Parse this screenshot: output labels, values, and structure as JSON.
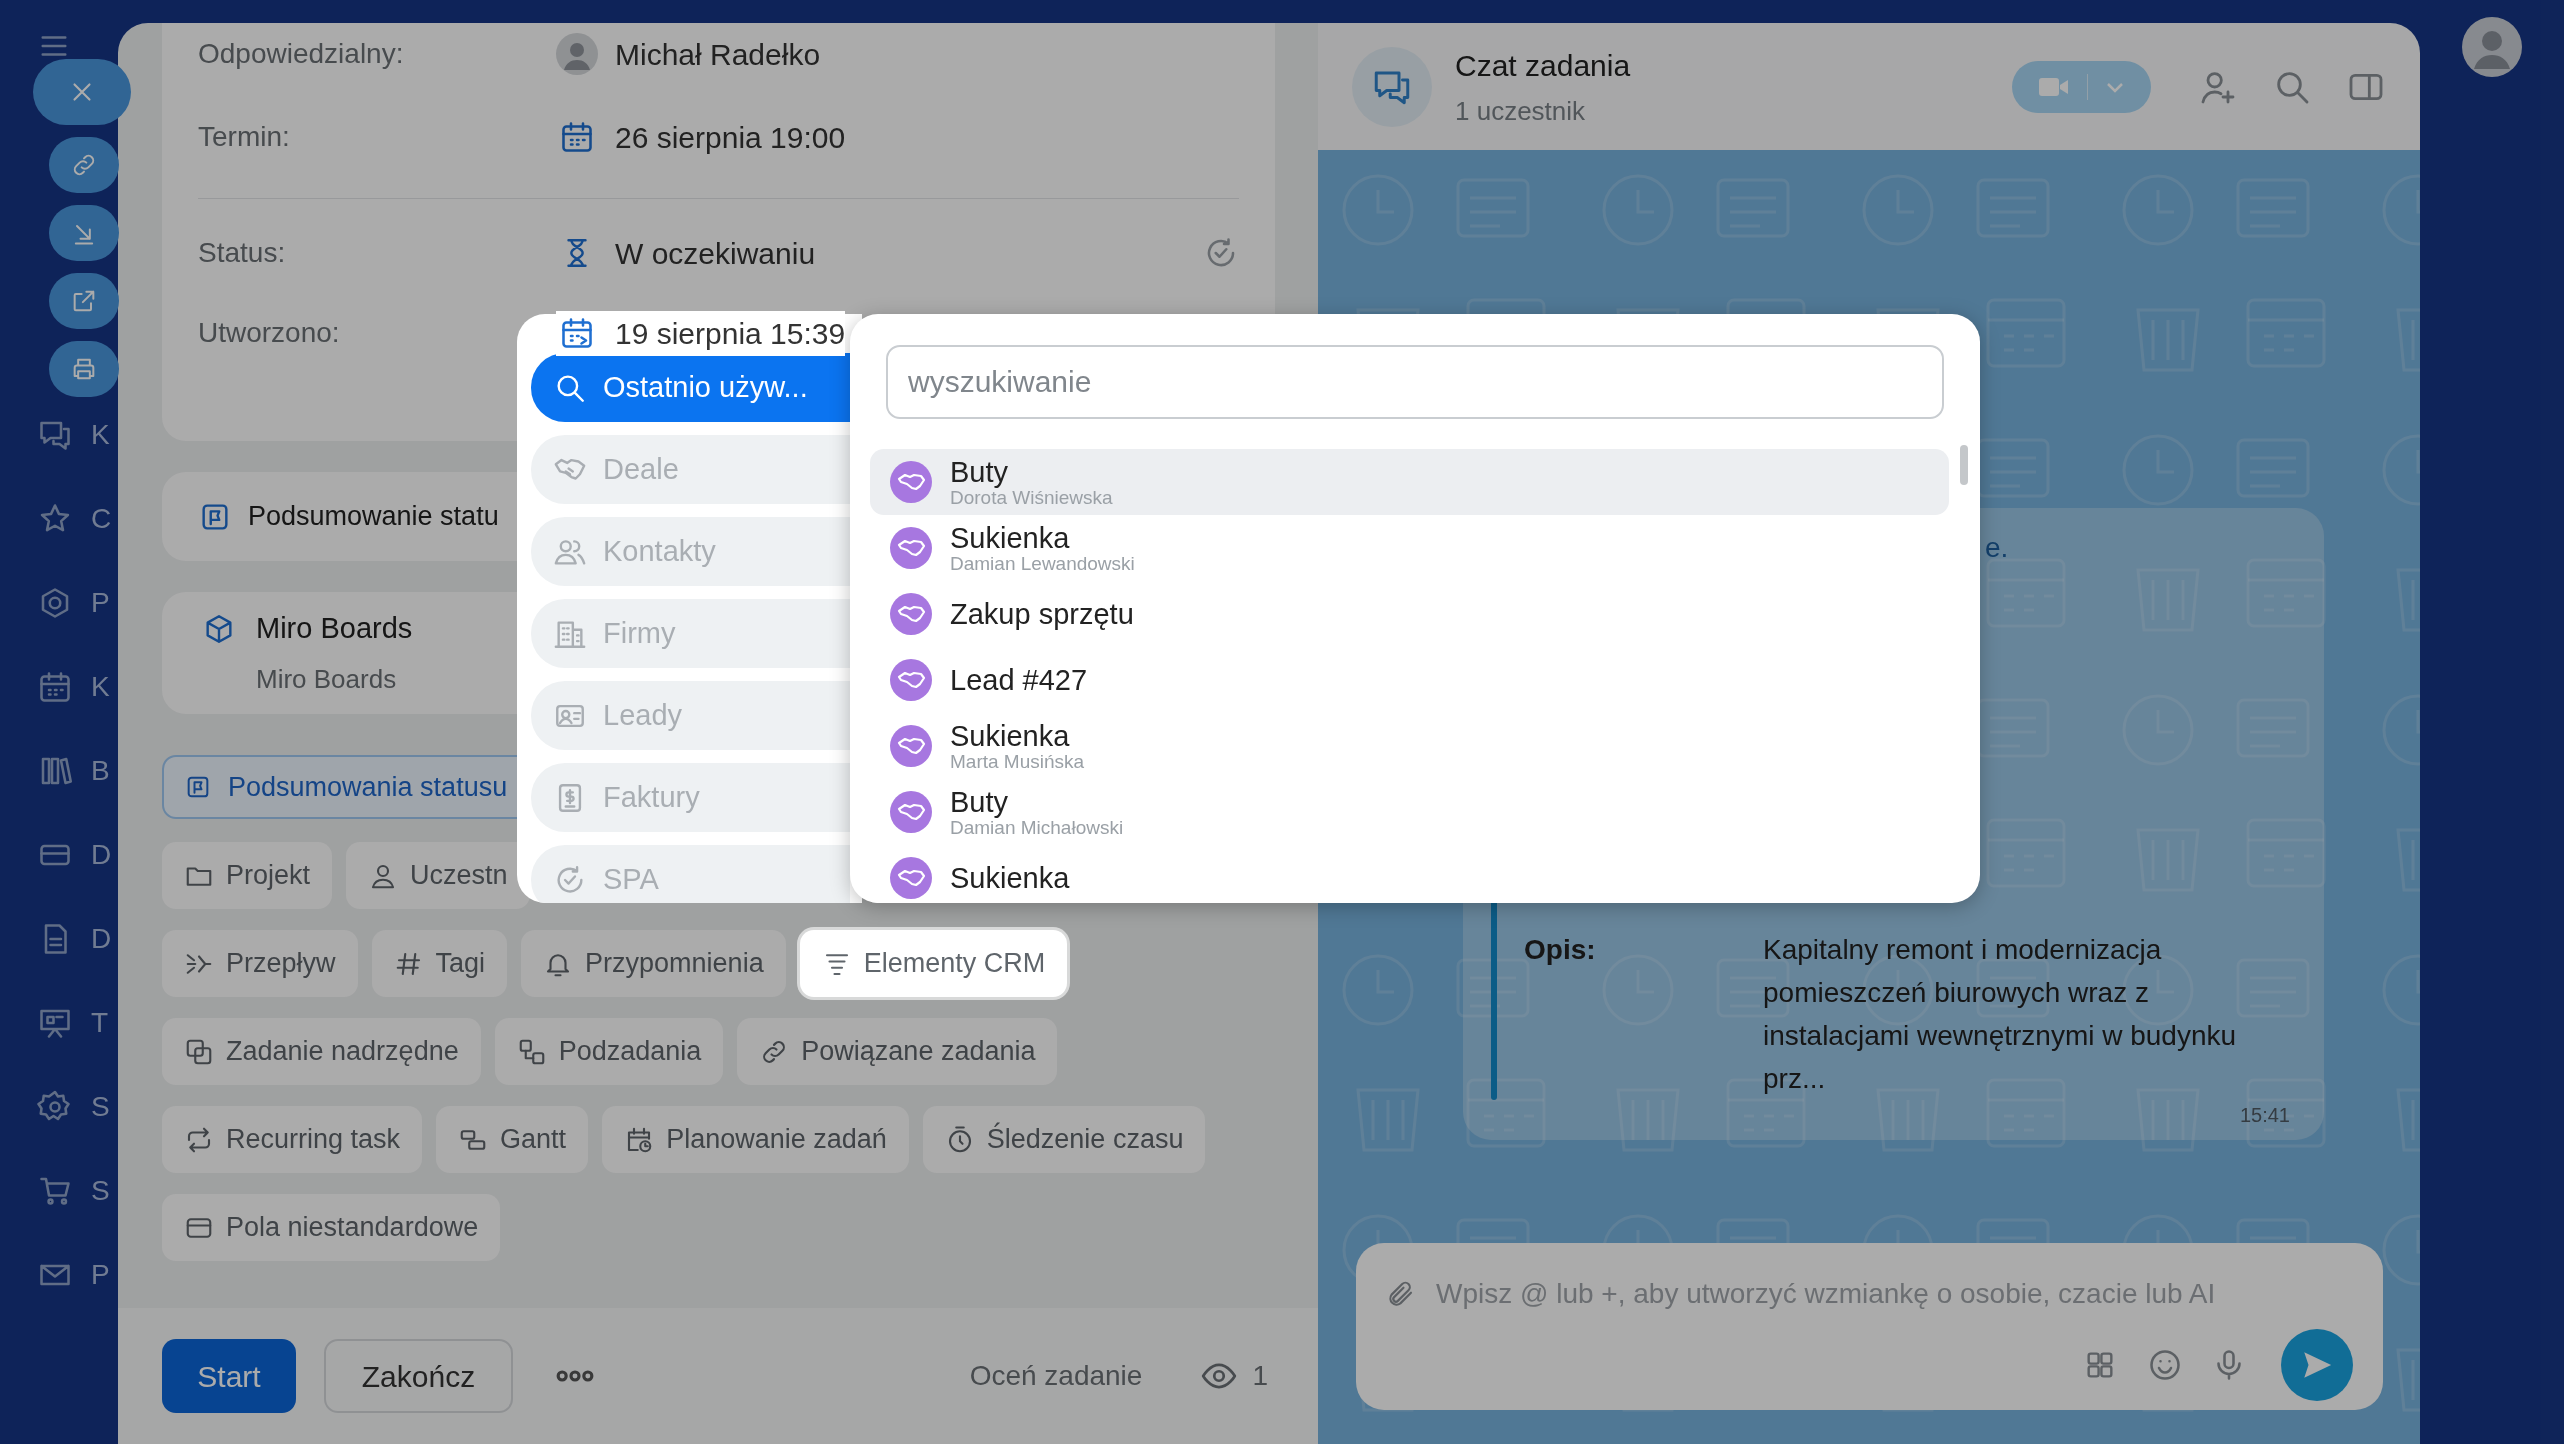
{
  "sidebar": {
    "items": [
      {
        "label": "K"
      },
      {
        "label": "C"
      },
      {
        "label": "P"
      },
      {
        "label": "K"
      },
      {
        "label": "B"
      },
      {
        "label": "D"
      },
      {
        "label": "D"
      },
      {
        "label": "T"
      },
      {
        "label": "S"
      },
      {
        "label": "S"
      },
      {
        "label": "P"
      }
    ]
  },
  "task": {
    "fields": [
      {
        "label": "Odpowiedzialny:",
        "value": "Michał Radełko",
        "kind": "person"
      },
      {
        "label": "Termin:",
        "value": "26 sierpnia 19:00",
        "kind": "date"
      },
      {
        "label": "Status:",
        "value": "W oczekiwaniu",
        "kind": "status"
      },
      {
        "label": "Utworzono:",
        "value": "19 sierpnia 15:39",
        "kind": "created"
      }
    ],
    "summary_notice": "Podsumowanie statu",
    "app_card": {
      "title": "Miro Boards",
      "subtitle": "Miro Boards"
    },
    "summary_link": "Podsumowania statusu",
    "chip_rows": [
      [
        {
          "label": "Projekt",
          "highlighted": false
        },
        {
          "label": "Uczestn",
          "highlighted": false
        }
      ],
      [
        {
          "label": "Przepływ",
          "highlighted": false
        },
        {
          "label": "Tagi",
          "highlighted": false
        },
        {
          "label": "Przypomnienia",
          "highlighted": false
        },
        {
          "label": "Elementy CRM",
          "highlighted": true
        }
      ],
      [
        {
          "label": "Zadanie nadrzędne",
          "highlighted": false
        },
        {
          "label": "Podzadania",
          "highlighted": false
        },
        {
          "label": "Powiązane zadania",
          "highlighted": false
        }
      ],
      [
        {
          "label": "Recurring task",
          "highlighted": false
        },
        {
          "label": "Gantt",
          "highlighted": false
        },
        {
          "label": "Planowanie zadań",
          "highlighted": false
        },
        {
          "label": "Śledzenie czasu",
          "highlighted": false
        }
      ],
      [
        {
          "label": "Pola niestandardowe",
          "highlighted": false
        }
      ]
    ],
    "actions": {
      "start": "Start",
      "finish": "Zakończ",
      "rate": "Oceń zadanie",
      "views": "1"
    }
  },
  "popup": {
    "tabs": [
      {
        "label": "Ostatnio używ...",
        "selected": true
      },
      {
        "label": "Deale",
        "selected": false
      },
      {
        "label": "Kontakty",
        "selected": false
      },
      {
        "label": "Firmy",
        "selected": false
      },
      {
        "label": "Leady",
        "selected": false
      },
      {
        "label": "Faktury",
        "selected": false
      },
      {
        "label": "SPA",
        "selected": false
      }
    ],
    "search": {
      "placeholder": "wyszukiwanie"
    },
    "results": [
      {
        "title": "Buty",
        "subtitle": "Dorota Wiśniewska",
        "highlighted": true
      },
      {
        "title": "Sukienka",
        "subtitle": "Damian Lewandowski",
        "highlighted": false
      },
      {
        "title": "Zakup sprzętu",
        "highlighted": false
      },
      {
        "title": "Lead #427",
        "highlighted": false
      },
      {
        "title": "Sukienka",
        "subtitle": "Marta Musińska",
        "highlighted": false
      },
      {
        "title": "Buty",
        "subtitle": "Damian Michałowski",
        "highlighted": false
      },
      {
        "title": "Sukienka",
        "highlighted": false
      }
    ]
  },
  "chat": {
    "title": "Czat zadania",
    "subtitle": "1 uczestnik",
    "message": {
      "fragment": "e.",
      "fields": [
        {
          "label": "Opis:",
          "value": "Kapitalny remont i modernizacja pomieszczeń biurowych wraz z instalacjami wewnętrznymi w budynku prz..."
        }
      ],
      "time": "15:41"
    },
    "input": {
      "placeholder": "Wpisz @ lub +, aby utworzyć wzmiankę o osobie, czacie lub AI"
    }
  }
}
